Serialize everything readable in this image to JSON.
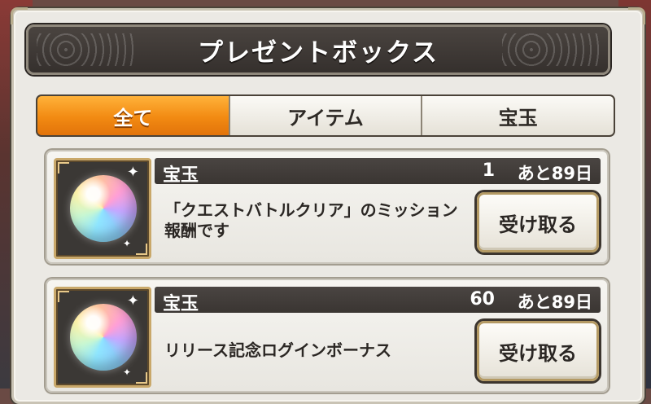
{
  "dialog": {
    "title": "プレゼントボックス"
  },
  "tabs": [
    {
      "label": "全て",
      "active": true
    },
    {
      "label": "アイテム",
      "active": false
    },
    {
      "label": "宝玉",
      "active": false
    }
  ],
  "presents": [
    {
      "icon": "jewel-orb-icon",
      "name": "宝玉",
      "quantity": "1",
      "expiry": "あと89日",
      "description": "「クエストバトルクリア」のミッション報酬です",
      "receive_label": "受け取る"
    },
    {
      "icon": "jewel-orb-icon",
      "name": "宝玉",
      "quantity": "60",
      "expiry": "あと89日",
      "description": "リリース記念ログインボーナス",
      "receive_label": "受け取る"
    }
  ],
  "colors": {
    "active_tab": "#f28a12",
    "title_bar": "#3a3532",
    "panel": "#ebe9e4"
  }
}
